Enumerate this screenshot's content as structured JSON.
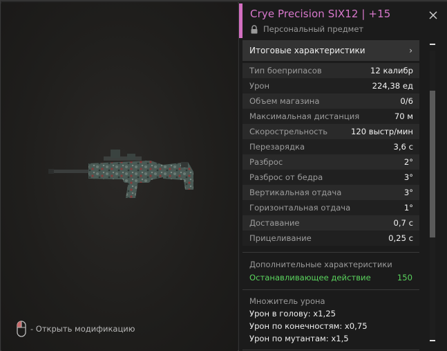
{
  "item": {
    "title": "Crye Precision SIX12 | +15",
    "subtitle": "Персональный предмет",
    "accent_color": "#d36fc1"
  },
  "preview": {
    "hint_text": "- Открыть модификацию",
    "hint_icon": "mouse-icon"
  },
  "stats_header": {
    "label": "Итоговые характеристики",
    "chevron": "›"
  },
  "stats": [
    {
      "label": "Тип боеприпасов",
      "value": "12 калибр"
    },
    {
      "label": "Урон",
      "value": "224,38 ед"
    },
    {
      "label": "Объем магазина",
      "value": "0/6"
    },
    {
      "label": "Максимальная дистанция",
      "value": "70 м"
    },
    {
      "label": "Скорострельность",
      "value": "120 выстр/мин"
    },
    {
      "label": "Перезарядка",
      "value": "3,6 с"
    },
    {
      "label": "Разброс",
      "value": "2°"
    },
    {
      "label": "Разброс от бедра",
      "value": "3°"
    },
    {
      "label": "Вертикальная отдача",
      "value": "3°"
    },
    {
      "label": "Горизонтальная отдача",
      "value": "1°"
    },
    {
      "label": "Доставание",
      "value": "0,7 с"
    },
    {
      "label": "Прицеливание",
      "value": "0,25 с"
    }
  ],
  "extra": {
    "heading": "Дополнительные характеристики",
    "label": "Останавливающее действие",
    "value": "150",
    "color": "#5ad35d"
  },
  "multiplier": {
    "heading": "Множитель урона",
    "items": [
      "Урон в голову: x1,25",
      "Урон по конечностям: x0,75",
      "Урон по мутантам: x1,5"
    ]
  }
}
